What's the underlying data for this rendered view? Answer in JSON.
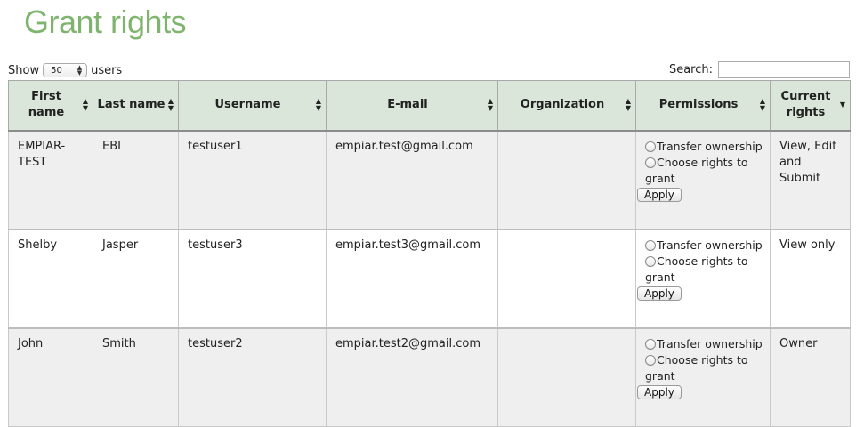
{
  "page": {
    "title": "Grant rights"
  },
  "controls": {
    "show_label": "Show",
    "page_size": "50",
    "users_label": "users",
    "search_label": "Search:",
    "search_value": ""
  },
  "table": {
    "headers": {
      "first_name": "First name",
      "last_name": "Last name",
      "username": "Username",
      "email": "E-mail",
      "organization": "Organization",
      "permissions": "Permissions",
      "current_rights": "Current rights"
    },
    "permissions_options": {
      "transfer": "Transfer ownership",
      "choose": "Choose rights to grant",
      "apply": "Apply"
    },
    "rows": [
      {
        "first_name": "EMPIAR-TEST",
        "last_name": "EBI",
        "username": "testuser1",
        "email": "empiar.test@gmail.com",
        "organization": "",
        "current_rights": "View, Edit and Submit"
      },
      {
        "first_name": "Shelby",
        "last_name": "Jasper",
        "username": "testuser3",
        "email": "empiar.test3@gmail.com",
        "organization": "",
        "current_rights": "View only"
      },
      {
        "first_name": "John",
        "last_name": "Smith",
        "username": "testuser2",
        "email": "empiar.test2@gmail.com",
        "organization": "",
        "current_rights": "Owner"
      }
    ]
  },
  "colors": {
    "title": "#7fb46e",
    "header_bg": "#d9e6d9",
    "row_odd_bg": "#efefef",
    "row_even_bg": "#ffffff"
  },
  "icons": {
    "sort": "sort-both-icon",
    "sort_desc": "sort-desc-icon"
  }
}
